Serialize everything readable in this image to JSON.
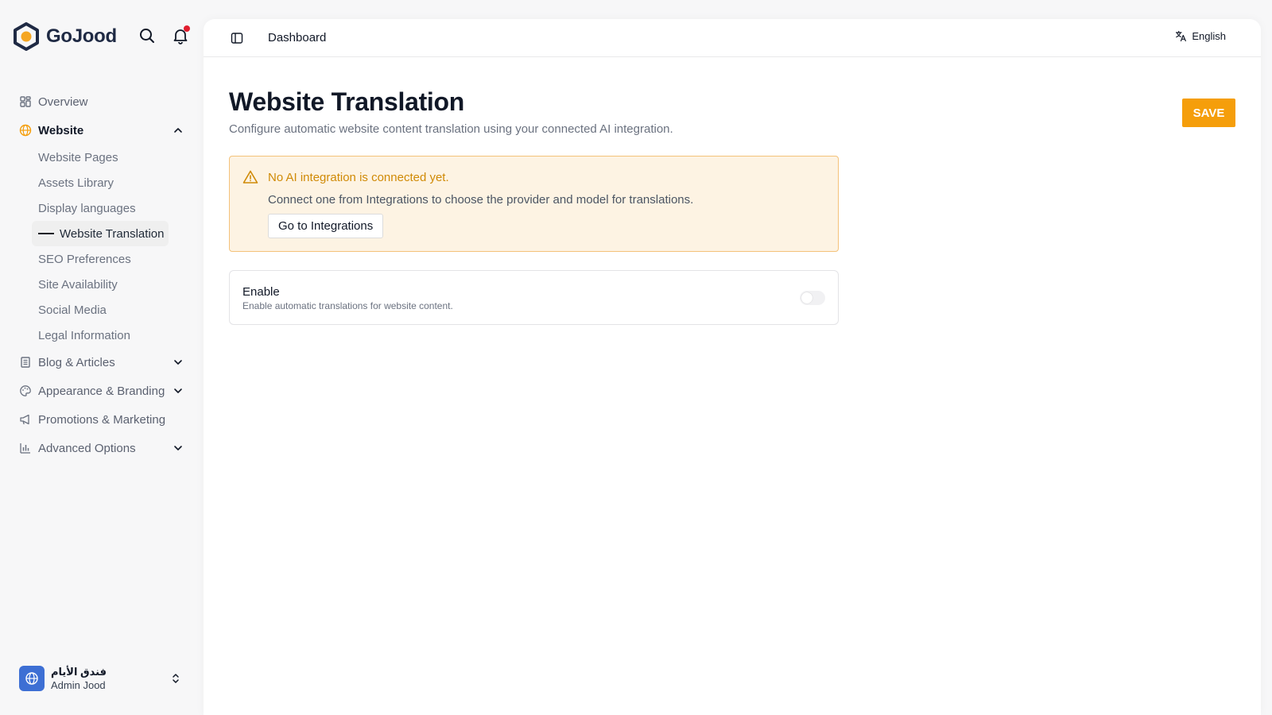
{
  "brand": {
    "name": "GoJood"
  },
  "colors": {
    "accent": "#f59e0b",
    "alert_bg": "#fdf3e3",
    "alert_border": "#f4c27a",
    "brand_dark": "#1f2a44"
  },
  "sidebar": {
    "items": [
      {
        "label": "Overview",
        "icon": "grid-icon"
      },
      {
        "label": "Website",
        "icon": "globe-icon",
        "expanded": true,
        "children": [
          {
            "label": "Website Pages"
          },
          {
            "label": "Assets Library"
          },
          {
            "label": "Display languages"
          },
          {
            "label": "Website Translation",
            "current": true
          },
          {
            "label": "SEO Preferences"
          },
          {
            "label": "Site Availability"
          },
          {
            "label": "Social Media"
          },
          {
            "label": "Legal Information"
          }
        ]
      },
      {
        "label": "Blog & Articles",
        "icon": "document-icon"
      },
      {
        "label": "Appearance & Branding",
        "icon": "palette-icon"
      },
      {
        "label": "Promotions & Marketing",
        "icon": "megaphone-icon"
      },
      {
        "label": "Advanced Options",
        "icon": "bar-chart-icon"
      }
    ]
  },
  "user": {
    "name": "فندق الأيام",
    "role": "Admin Jood"
  },
  "topbar": {
    "breadcrumb": "Dashboard",
    "language": "English"
  },
  "page": {
    "title": "Website Translation",
    "subtitle": "Configure automatic website content translation using your connected AI integration.",
    "save_label": "SAVE"
  },
  "alert": {
    "title": "No AI integration is connected yet.",
    "description": "Connect one from Integrations to choose the provider and model for translations.",
    "button_label": "Go to Integrations"
  },
  "enable": {
    "title": "Enable",
    "description": "Enable automatic translations for website content.",
    "toggle_on": false
  }
}
